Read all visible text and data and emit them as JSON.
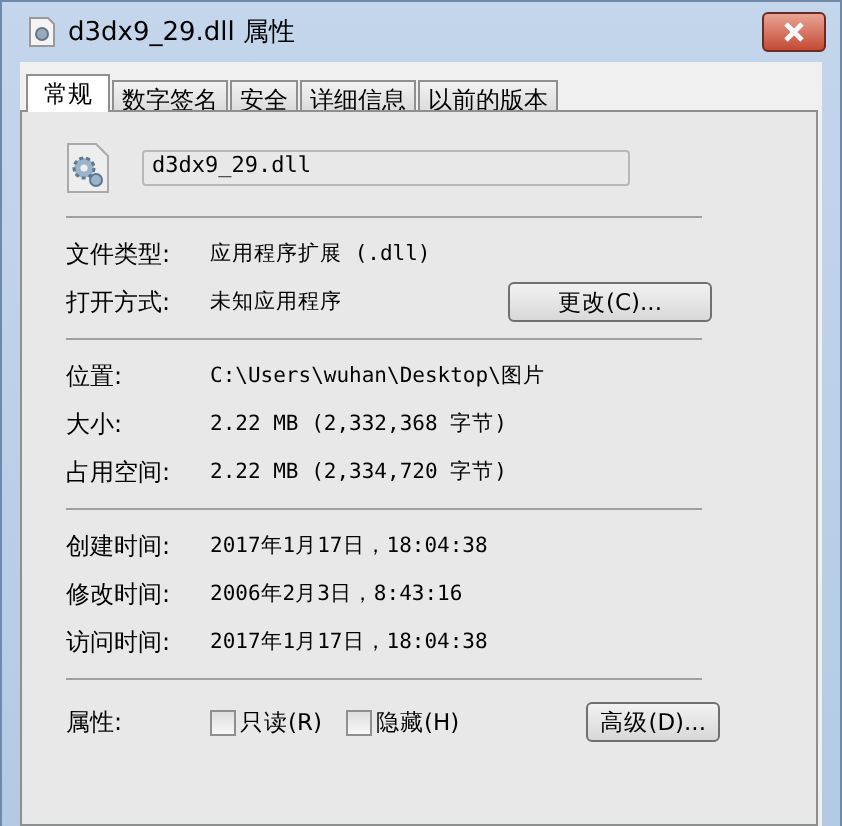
{
  "window": {
    "title": "d3dx9_29.dll 属性"
  },
  "tabs": [
    {
      "label": "常规",
      "selected": true
    },
    {
      "label": "数字签名",
      "selected": false
    },
    {
      "label": "安全",
      "selected": false
    },
    {
      "label": "详细信息",
      "selected": false
    },
    {
      "label": "以前的版本",
      "selected": false
    }
  ],
  "file_name": "d3dx9_29.dll",
  "groups": [
    [
      {
        "label": "文件类型:",
        "value": "应用程序扩展 (.dll)"
      },
      {
        "label": "打开方式:",
        "value": "未知应用程序",
        "button": "更改(C)..."
      }
    ],
    [
      {
        "label": "位置:",
        "value": "C:\\Users\\wuhan\\Desktop\\图片"
      },
      {
        "label": "大小:",
        "value": "2.22 MB (2,332,368 字节)"
      },
      {
        "label": "占用空间:",
        "value": "2.22 MB (2,334,720 字节)"
      }
    ],
    [
      {
        "label": "创建时间:",
        "value": "2017年1月17日，18:04:38"
      },
      {
        "label": "修改时间:",
        "value": "2006年2月3日，8:43:16"
      },
      {
        "label": "访问时间:",
        "value": "2017年1月17日，18:04:38"
      }
    ]
  ],
  "attributes": {
    "label": "属性:",
    "checkboxes": [
      {
        "label": "只读(R)",
        "checked": false
      },
      {
        "label": "隐藏(H)",
        "checked": false
      }
    ],
    "button": "高级(D)..."
  }
}
